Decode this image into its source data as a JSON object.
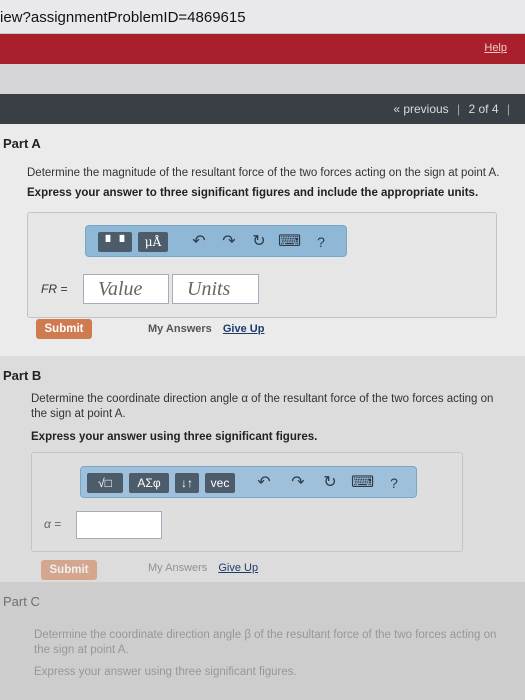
{
  "browser": {
    "url_text": "iew?assignmentProblemID=4869615"
  },
  "header": {
    "help_label": "Help"
  },
  "nav": {
    "previous_label": "« previous",
    "position_label": "2 of 4",
    "sep": "|"
  },
  "partA": {
    "title": "Part A",
    "question": "Determine the magnitude of the resultant force of the two forces acting on the sign at point A.",
    "instruction": "Express your answer to three significant figures and include the appropriate units.",
    "toolbar": {
      "templates": "▘▝",
      "units": "μÅ",
      "undo": "↶",
      "redo": "↷",
      "reset": "↻",
      "keyboard": "⌨",
      "help": "?"
    },
    "field_label": "FR =",
    "value_placeholder": "Value",
    "units_placeholder": "Units",
    "submit_label": "Submit",
    "my_answers_label": "My Answers",
    "give_up_label": "Give Up"
  },
  "partB": {
    "title": "Part B",
    "question": "Determine the coordinate direction angle α of the resultant force of the two forces acting on the sign at point A.",
    "instruction": "Express your answer using three significant figures.",
    "toolbar": {
      "templates": "√□",
      "symbols": "ΑΣφ",
      "sort": "↓↑",
      "vec": "vec",
      "undo": "↶",
      "redo": "↷",
      "reset": "↻",
      "keyboard": "⌨",
      "help": "?"
    },
    "field_label": "α =",
    "submit_label": "Submit",
    "my_answers_label": "My Answers",
    "give_up_label": "Give Up"
  },
  "partC": {
    "title": "Part C",
    "question": "Determine the coordinate direction angle β of the resultant force of the two forces acting on the sign at point A.",
    "instruction": "Express your answer using three significant figures."
  }
}
